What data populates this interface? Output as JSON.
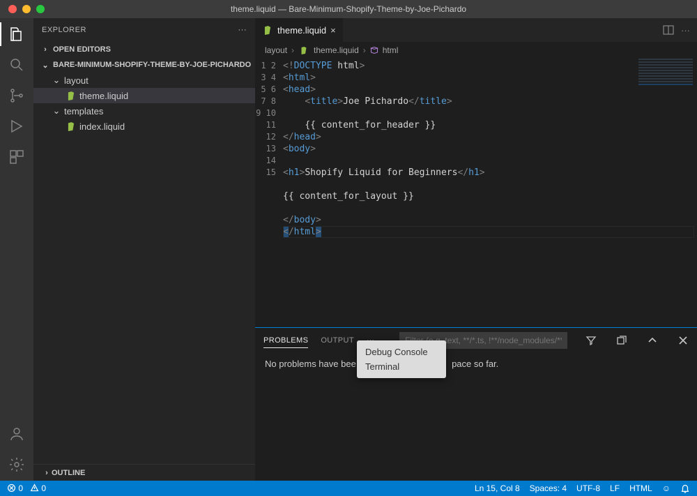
{
  "title": "theme.liquid — Bare-Minimum-Shopify-Theme-by-Joe-Pichardo",
  "sidebar": {
    "title": "EXPLORER",
    "openEditors": "OPEN EDITORS",
    "project": "BARE-MINIMUM-SHOPIFY-THEME-BY-JOE-PICHARDO",
    "folders": {
      "layout": "layout",
      "templates": "templates"
    },
    "files": {
      "theme": "theme.liquid",
      "index": "index.liquid"
    },
    "outline": "OUTLINE"
  },
  "tab": {
    "label": "theme.liquid"
  },
  "breadcrumbs": {
    "a": "layout",
    "b": "theme.liquid",
    "c": "html"
  },
  "code": {
    "l1": "<!DOCTYPE html>",
    "l2": "<html>",
    "l3": "<head>",
    "l4": "    <title>Joe Pichardo</title>",
    "l5": "",
    "l6": "    {{ content_for_header }}",
    "l7": "</head>",
    "l8": "<body>",
    "l9": "",
    "l10": "<h1>Shopify Liquid for Beginners</h1>",
    "l11": "",
    "l12": "{{ content_for_layout }}",
    "l13": "",
    "l14": "</body>",
    "l15": "</html>"
  },
  "panel": {
    "tabs": {
      "problems": "PROBLEMS",
      "output": "OUTPUT"
    },
    "filterPlaceholder": "Filter (e.g. text, **/*.ts, !**/node_modules/**)",
    "message": "No problems have bee",
    "messageTail": "pace so far."
  },
  "popup": {
    "item1": "Debug Console",
    "item2": "Terminal"
  },
  "status": {
    "errors": "0",
    "warnings": "0",
    "lncol": "Ln 15, Col 8",
    "spaces": "Spaces: 4",
    "encoding": "UTF-8",
    "eol": "LF",
    "lang": "HTML",
    "smiley": "☺"
  }
}
